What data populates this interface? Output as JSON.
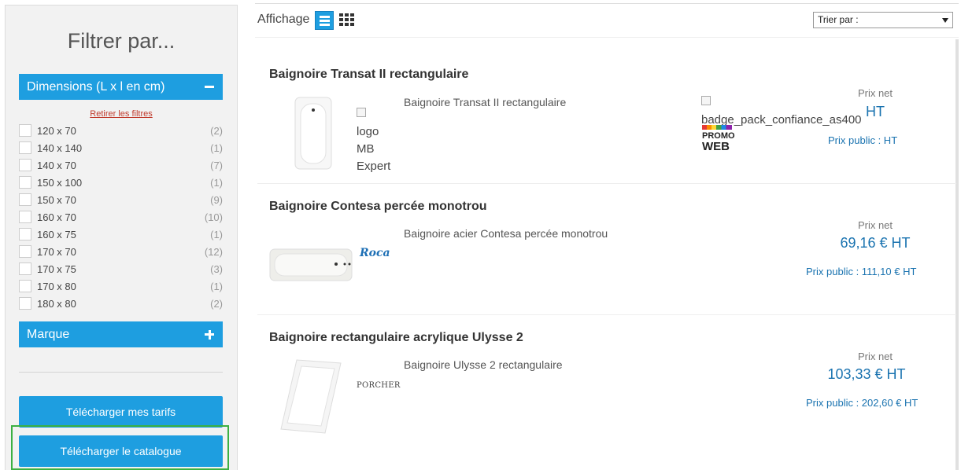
{
  "sidebar": {
    "title": "Filtrer par...",
    "dimensions_label": "Dimensions (L x l en cm)",
    "remove_filters": "Retirer les filtres",
    "filters": [
      {
        "label": "120 x 70",
        "count": "(2)"
      },
      {
        "label": "140 x 140",
        "count": "(1)"
      },
      {
        "label": "140 x 70",
        "count": "(7)"
      },
      {
        "label": "150 x 100",
        "count": "(1)"
      },
      {
        "label": "150 x 70",
        "count": "(9)"
      },
      {
        "label": "160 x 70",
        "count": "(10)"
      },
      {
        "label": "160 x 75",
        "count": "(1)"
      },
      {
        "label": "170 x 70",
        "count": "(12)"
      },
      {
        "label": "170 x 75",
        "count": "(3)"
      },
      {
        "label": "170 x 80",
        "count": "(1)"
      },
      {
        "label": "180 x 80",
        "count": "(2)"
      }
    ],
    "marque_label": "Marque",
    "btn_tarifs": "Télécharger mes tarifs",
    "btn_catalogue": "Télécharger le catalogue"
  },
  "topbar": {
    "affichage": "Affichage",
    "sort_label": "Trier par :"
  },
  "products": [
    {
      "title": "Baignoire Transat II rectangulaire",
      "desc": "Baignoire Transat II rectangulaire",
      "brand_alt": [
        "logo",
        "MB",
        "Expert"
      ],
      "badge_alt": "badge_pack_confiance_as400",
      "promo": [
        "PROMO",
        "WEB"
      ],
      "prix_net_label": "Prix net",
      "price": "HT",
      "prix_public": "Prix public :  HT"
    },
    {
      "title": "Baignoire Contesa percée monotrou",
      "desc": "Baignoire acier Contesa percée monotrou",
      "brand": "Roca",
      "prix_net_label": "Prix net",
      "price": "69,16 € HT",
      "prix_public": "Prix public : 111,10 €  HT"
    },
    {
      "title": "Baignoire rectangulaire acrylique Ulysse 2",
      "desc": "Baignoire Ulysse 2 rectangulaire",
      "brand": "PORCHER",
      "prix_net_label": "Prix net",
      "price": "103,33 € HT",
      "prix_public": "Prix public : 202,60 €  HT"
    }
  ],
  "colors": {
    "accent": "#1e9ee0",
    "price": "#1a73b0",
    "highlight": "#3cb043"
  }
}
